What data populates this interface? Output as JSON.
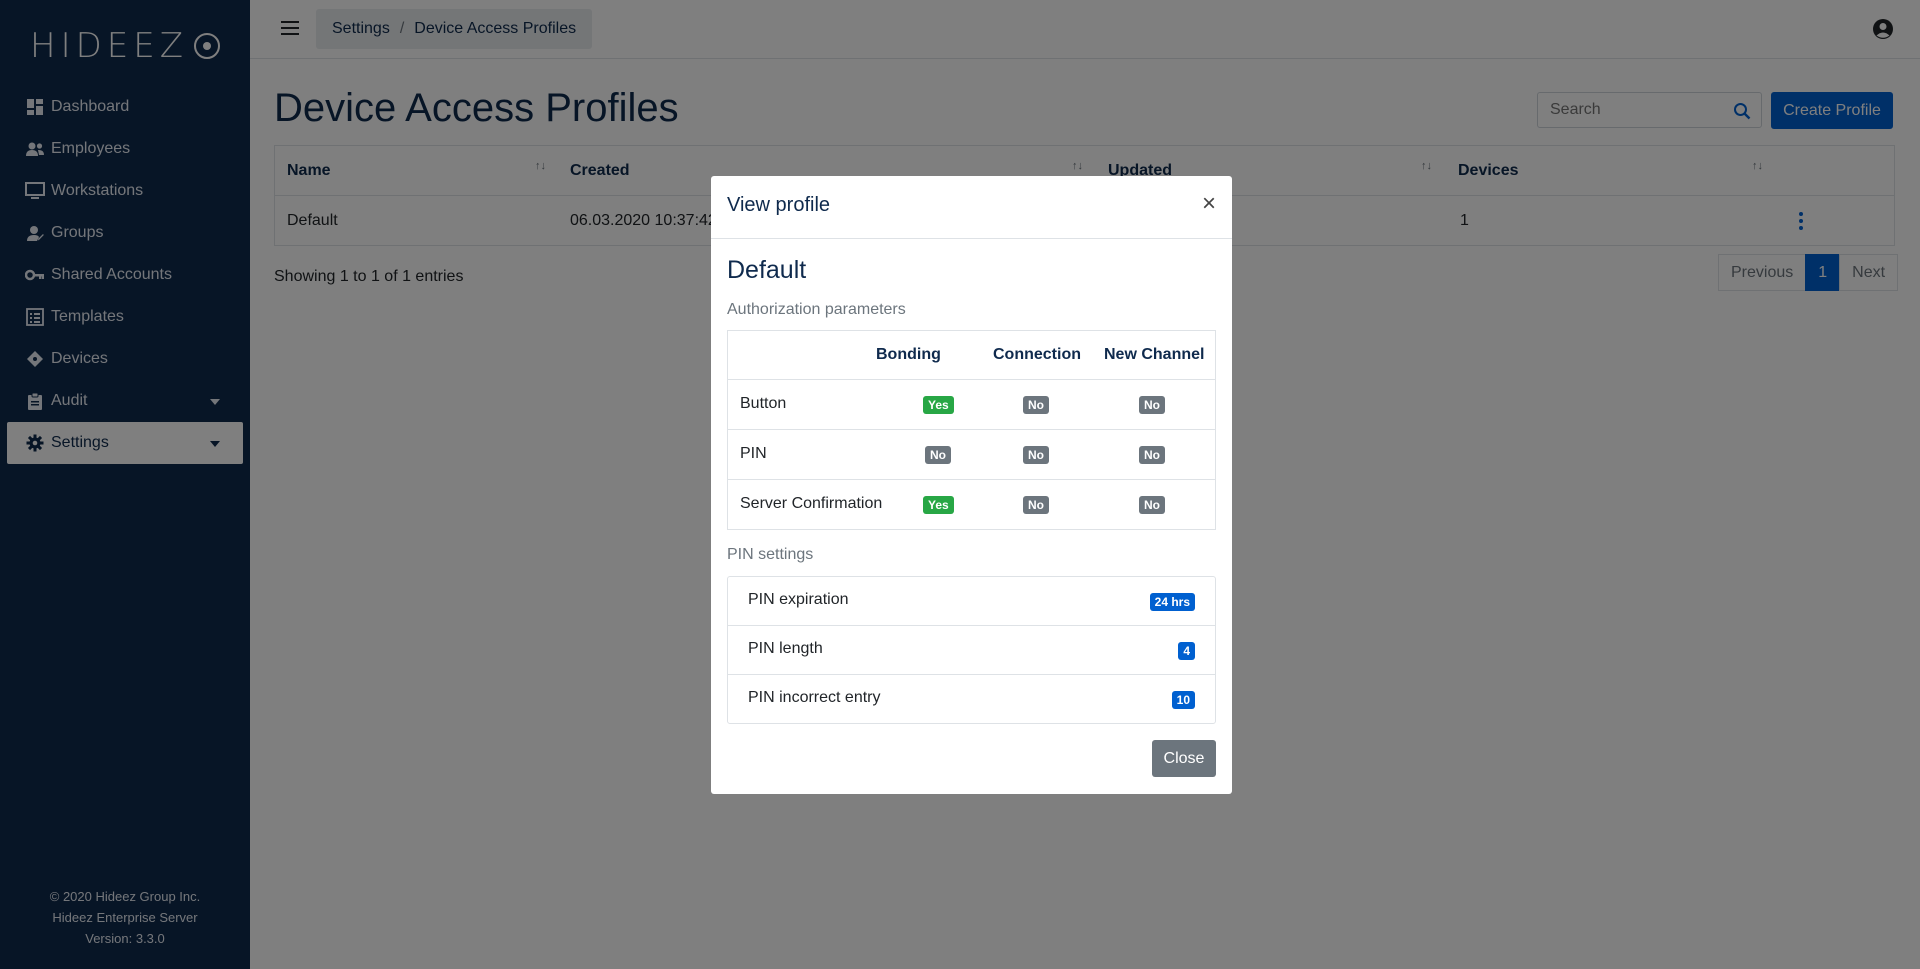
{
  "sidebar": {
    "logo_text": "HIDEEZ",
    "items": [
      {
        "label": "Dashboard",
        "icon": "dashboard-icon"
      },
      {
        "label": "Employees",
        "icon": "users-icon"
      },
      {
        "label": "Workstations",
        "icon": "monitor-icon"
      },
      {
        "label": "Groups",
        "icon": "user-group-icon"
      },
      {
        "label": "Shared Accounts",
        "icon": "key-icon"
      },
      {
        "label": "Templates",
        "icon": "list-icon"
      },
      {
        "label": "Devices",
        "icon": "device-icon"
      },
      {
        "label": "Audit",
        "icon": "clipboard-icon"
      },
      {
        "label": "Settings",
        "icon": "gear-icon"
      }
    ],
    "footer": {
      "copyright": "© 2020 Hideez Group Inc.",
      "product": "Hideez Enterprise Server",
      "version": "Version: 3.3.0"
    }
  },
  "header": {
    "breadcrumb": [
      "Settings",
      "Device Access Profiles"
    ],
    "breadcrumb_sep": "/"
  },
  "main": {
    "title": "Device Access Profiles",
    "search_placeholder": "Search",
    "create_label": "Create Profile",
    "columns": [
      "Name",
      "Created",
      "Updated",
      "Devices"
    ],
    "rows": [
      {
        "name": "Default",
        "created": "06.03.2020 10:37:42",
        "updated": "",
        "devices": "1"
      }
    ],
    "showing": "Showing 1 to 1 of 1 entries",
    "pager": {
      "prev": "Previous",
      "page": "1",
      "next": "Next"
    }
  },
  "modal": {
    "title": "View profile",
    "close_x": "×",
    "profile_name": "Default",
    "auth_label": "Authorization parameters",
    "auth_columns": [
      "Bonding",
      "Connection",
      "New Channel"
    ],
    "auth_rows": [
      {
        "label": "Button",
        "values": [
          "Yes",
          "No",
          "No"
        ]
      },
      {
        "label": "PIN",
        "values": [
          "No",
          "No",
          "No"
        ]
      },
      {
        "label": "Server Confirmation",
        "values": [
          "Yes",
          "No",
          "No"
        ]
      }
    ],
    "pin_label": "PIN settings",
    "pin_rows": [
      {
        "label": "PIN expiration",
        "value": "24 hrs"
      },
      {
        "label": "PIN length",
        "value": "4"
      },
      {
        "label": "PIN incorrect entry",
        "value": "10"
      }
    ],
    "close_label": "Close"
  },
  "colors": {
    "sidebar_bg": "#0f2a4d",
    "primary": "#0060d0",
    "success": "#28a745",
    "secondary": "#6c757d"
  }
}
